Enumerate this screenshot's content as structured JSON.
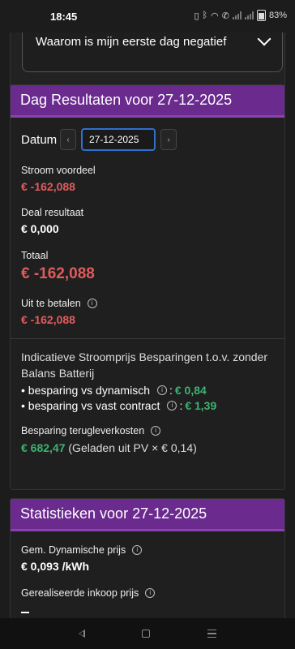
{
  "status_bar": {
    "time": "18:45",
    "battery": "83%"
  },
  "faq": {
    "question": "Waarom is mijn eerste dag negatief"
  },
  "results": {
    "title": "Dag Resultaten voor 27-12-2025",
    "date_label": "Datum",
    "date_value": "27-12-2025",
    "prev_icon": "chevron-left-icon",
    "next_icon": "chevron-right-icon",
    "stroom_voordeel_label": "Stroom voordeel",
    "stroom_voordeel_value": "€ -162,088",
    "deal_resultaat_label": "Deal resultaat",
    "deal_resultaat_value": "€ 0,000",
    "totaal_label": "Totaal",
    "totaal_value": "€ -162,088",
    "uit_te_betalen_label": "Uit te betalen",
    "uit_te_betalen_value": "€ -162,088",
    "indicative_text": "Indicatieve Stroomprijs Besparingen t.o.v. zonder Balans Batterij",
    "bullet_dynamisch_label": "• besparing vs dynamisch",
    "bullet_dynamisch_value": "€ 0,84",
    "bullet_vast_label": "• besparing vs vast contract",
    "bullet_vast_value": "€ 1,39",
    "terug_label": "Besparing terugleverkosten",
    "terug_value": "€ 682,47",
    "terug_note": "(Geladen uit PV × € 0,14)"
  },
  "stats": {
    "title": "Statistieken voor 27-12-2025",
    "dyn_label": "Gem. Dynamische prijs",
    "dyn_value": "€ 0,093 /kWh",
    "inkoop_label": "Gerealiseerde inkoop prijs"
  },
  "colors": {
    "header_purple": "#6a2a8e",
    "negative_red": "#e05c5c",
    "positive_green": "#3cb371",
    "date_focus_blue": "#2f6fcf"
  }
}
